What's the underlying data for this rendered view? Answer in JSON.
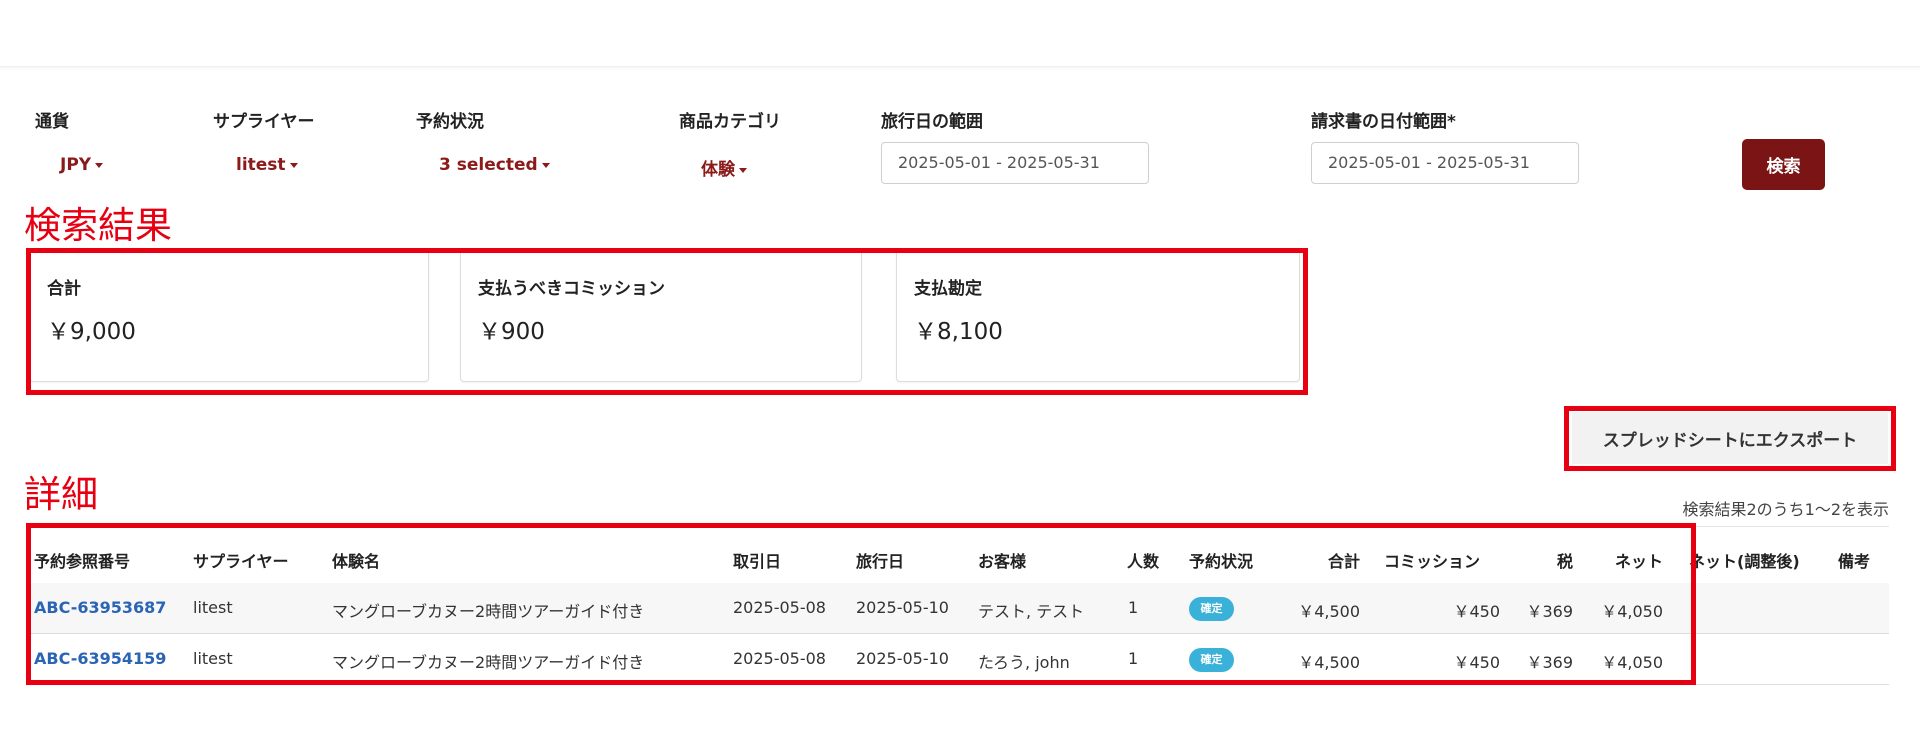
{
  "filters": {
    "currency": {
      "label": "通貨",
      "value": "JPY"
    },
    "supplier": {
      "label": "サプライヤー",
      "value": "litest"
    },
    "status": {
      "label": "予約状況",
      "value": "3 selected"
    },
    "category": {
      "label": "商品カテゴリ",
      "value": "体験"
    },
    "travel_date": {
      "label": "旅行日の範囲",
      "value": "2025-05-01 - 2025-05-31"
    },
    "invoice_date": {
      "label": "請求書の日付範囲*",
      "value": "2025-05-01 - 2025-05-31"
    },
    "search_label": "検索"
  },
  "annotations": {
    "results_heading": "検索結果",
    "details_heading": "詳細",
    "color": "#e60012"
  },
  "summary": {
    "total": {
      "label": "合計",
      "value": "￥9,000"
    },
    "commission": {
      "label": "支払うべきコミッション",
      "value": "￥900"
    },
    "payable": {
      "label": "支払勘定",
      "value": "￥8,100"
    }
  },
  "export_label": "スプレッドシートにエクスポート",
  "result_count": "検索結果2のうち1〜2を表示",
  "table": {
    "headers": {
      "ref": "予約参照番号",
      "supplier": "サプライヤー",
      "experience": "体験名",
      "transaction_date": "取引日",
      "travel_date": "旅行日",
      "customer": "お客様",
      "pax": "人数",
      "status": "予約状況",
      "total": "合計",
      "commission": "コミッション",
      "tax": "税",
      "net": "ネット",
      "net_adjusted": "ネット(調整後)",
      "notes": "備考"
    },
    "rows": [
      {
        "ref": "ABC-63953687",
        "supplier": "litest",
        "experience": "マングローブカヌー2時間ツアーガイド付き",
        "transaction_date": "2025-05-08",
        "travel_date": "2025-05-10",
        "customer": "テスト, テスト",
        "pax": "1",
        "status": "確定",
        "total": "￥4,500",
        "commission": "￥450",
        "tax": "￥369",
        "net": "￥4,050"
      },
      {
        "ref": "ABC-63954159",
        "supplier": "litest",
        "experience": "マングローブカヌー2時間ツアーガイド付き",
        "transaction_date": "2025-05-08",
        "travel_date": "2025-05-10",
        "customer": "たろう, john",
        "pax": "1",
        "status": "確定",
        "total": "￥4,500",
        "commission": "￥450",
        "tax": "￥369",
        "net": "￥4,050"
      }
    ]
  },
  "colors": {
    "accent": "#8b1a1a",
    "button": "#7b1515",
    "link": "#2a64b4",
    "badge": "#3ab1d8"
  }
}
